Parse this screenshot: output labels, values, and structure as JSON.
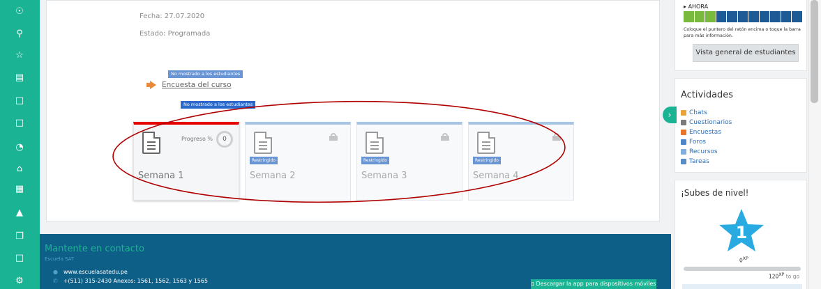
{
  "rail": {
    "icons": [
      "award-icon",
      "medal-icon",
      "star-icon",
      "book-icon",
      "folder-icon",
      "folder-icon",
      "gauge-icon",
      "home-icon",
      "calendar-icon",
      "graduation-cap-icon",
      "copy-icon",
      "folder-icon",
      "gear-icon"
    ]
  },
  "course": {
    "date_label": "Fecha: 27.07.2020",
    "status_label": "Estado: Programada",
    "hidden_tag_1": "No mostrado a los estudiantes",
    "survey_link": "Encuesta del curso",
    "hidden_tag_2": "No mostrado a los estudiantes"
  },
  "weeks": [
    {
      "title": "Semana 1",
      "progress_label": "Progreso %",
      "progress_value": "0",
      "restricted": false
    },
    {
      "title": "Semana 2",
      "restricted_label": "Restringido",
      "restricted": true
    },
    {
      "title": "Semana 3",
      "restricted_label": "Restringido",
      "restricted": true
    },
    {
      "title": "Semana 4",
      "restricted_label": "Restringido",
      "restricted": true
    }
  ],
  "footer": {
    "heading": "Mantente en contacto",
    "org": "Escuela SAT",
    "website": "www.escuelasatedu.pe",
    "phone": "+(511) 315-2430 Anexos: 1561, 1562, 1563 y 1565",
    "app_button": "Descargar la app para dispositivos móviles"
  },
  "sidebar": {
    "now_label": "AHORA",
    "progress_segments_total": 11,
    "progress_segments_done": 3,
    "hint": "Coloque el puntero del ratón encima o toque la barra para más información.",
    "overview_button": "Vista general de estudiantes",
    "activities_title": "Actividades",
    "activities": [
      {
        "label": "Chats",
        "color": "#e8a33a"
      },
      {
        "label": "Cuestionarios",
        "color": "#7a7a7a"
      },
      {
        "label": "Encuestas",
        "color": "#e8752a"
      },
      {
        "label": "Foros",
        "color": "#4b86c8"
      },
      {
        "label": "Recursos",
        "color": "#7fb0dd"
      },
      {
        "label": "Tareas",
        "color": "#5a8cc4"
      }
    ],
    "level_title": "¡Subes de nivel!",
    "level_number": "1",
    "xp_current": "0",
    "xp_unit": "XP",
    "xp_goal": "120",
    "xp_goal_suffix": "to go"
  },
  "colors": {
    "brand_green": "#1ab394",
    "footer_blue": "#0e5f87",
    "star_blue": "#29abe2",
    "annotation_red": "#b00000"
  }
}
